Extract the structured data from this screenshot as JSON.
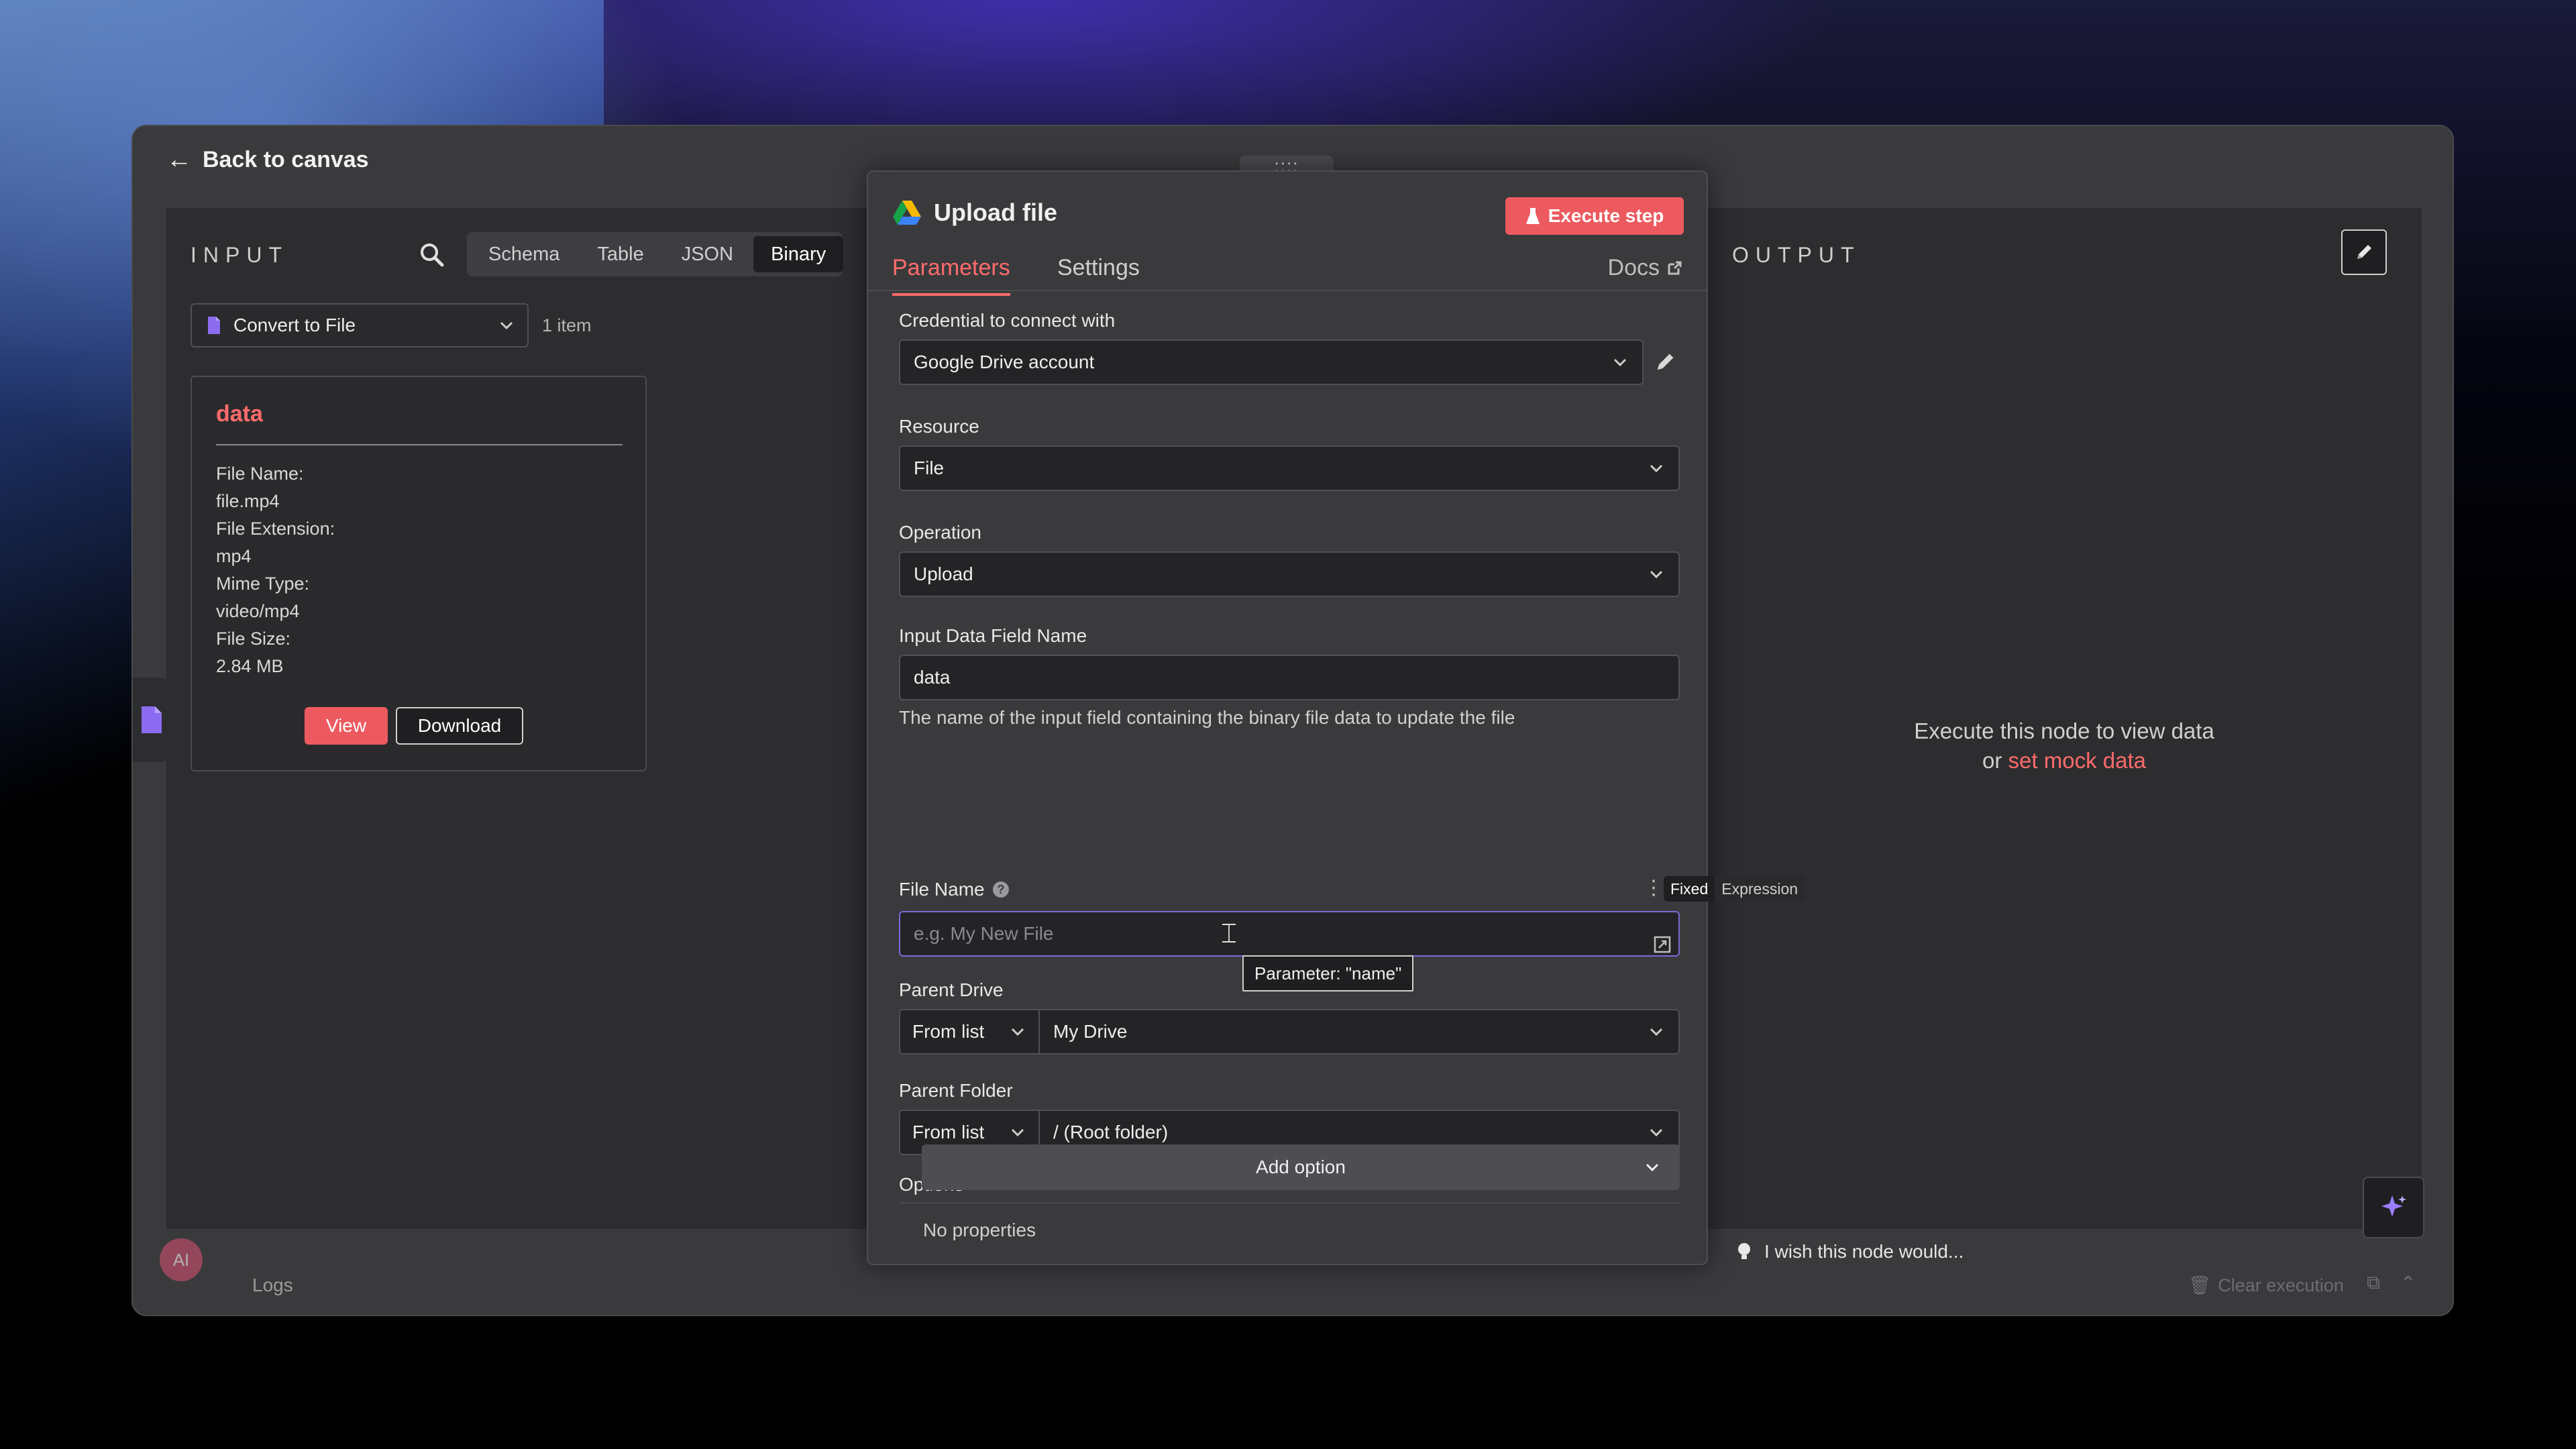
{
  "header": {
    "back_label": "Back to canvas",
    "drag_handle": "::::"
  },
  "input": {
    "title": "INPUT",
    "view_tabs": [
      "Schema",
      "Table",
      "JSON",
      "Binary"
    ],
    "active_view": "Binary",
    "node_select": "Convert to File",
    "item_count": "1 item",
    "card": {
      "title": "data",
      "fields": [
        {
          "label": "File Name:",
          "value": "file.mp4"
        },
        {
          "label": "File Extension:",
          "value": "mp4"
        },
        {
          "label": "Mime Type:",
          "value": "video/mp4"
        },
        {
          "label": "File Size:",
          "value": "2.84 MB"
        }
      ],
      "view_label": "View",
      "download_label": "Download"
    }
  },
  "node": {
    "title": "Upload file",
    "execute_label": "Execute step",
    "tabs": {
      "parameters": "Parameters",
      "settings": "Settings",
      "docs": "Docs"
    },
    "credential": {
      "label": "Credential to connect with",
      "value": "Google Drive account"
    },
    "resource": {
      "label": "Resource",
      "value": "File"
    },
    "operation": {
      "label": "Operation",
      "value": "Upload"
    },
    "input_field": {
      "label": "Input Data Field Name",
      "value": "data",
      "hint": "The name of the input field containing the binary file data to update the file"
    },
    "file_name": {
      "label": "File Name",
      "placeholder": "e.g. My New File",
      "fixed": "Fixed",
      "expression": "Expression",
      "tooltip": "Parameter: \"name\""
    },
    "parent_drive": {
      "label": "Parent Drive",
      "mode": "From list",
      "value": "My Drive"
    },
    "parent_folder": {
      "label": "Parent Folder",
      "mode": "From list",
      "value": "/ (Root folder)"
    },
    "options": {
      "label": "Options",
      "empty": "No properties",
      "add_label": "Add option"
    }
  },
  "output": {
    "title": "OUTPUT",
    "empty_line1": "Execute this node to view data",
    "empty_or": "or",
    "mock_link": "set mock data"
  },
  "footer": {
    "wish": "I wish this node would...",
    "avatar": "AI",
    "logs": "Logs",
    "clear_execution": "Clear execution"
  },
  "colors": {
    "accent": "#ec5a5f",
    "link": "#ff6b6b",
    "panel": "#2d2d30",
    "focus": "#7a6ad8"
  }
}
